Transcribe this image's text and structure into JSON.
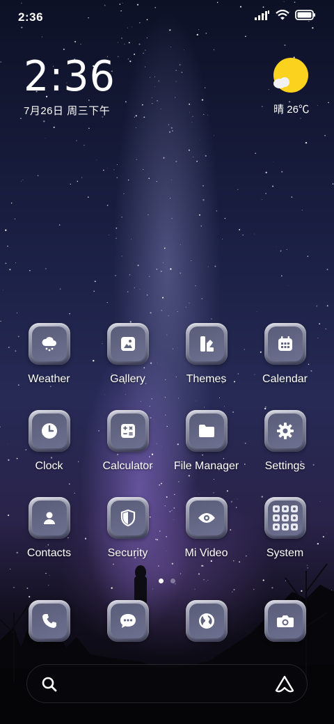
{
  "status_bar": {
    "time": "2:36",
    "icons": [
      "signal-icon",
      "wifi-icon",
      "battery-icon"
    ]
  },
  "clock_widget": {
    "time": "2:36",
    "date": "7月26日 周三下午"
  },
  "weather_widget": {
    "icon": "sun-cloud-icon",
    "text": "晴 26℃"
  },
  "apps": [
    {
      "label": "Weather",
      "icon": "weather-icon"
    },
    {
      "label": "Gallery",
      "icon": "gallery-icon"
    },
    {
      "label": "Themes",
      "icon": "themes-icon"
    },
    {
      "label": "Calendar",
      "icon": "calendar-icon"
    },
    {
      "label": "Clock",
      "icon": "clock-icon"
    },
    {
      "label": "Calculator",
      "icon": "calculator-icon"
    },
    {
      "label": "File Manager",
      "icon": "folder-icon"
    },
    {
      "label": "Settings",
      "icon": "gear-icon"
    },
    {
      "label": "Contacts",
      "icon": "contacts-icon"
    },
    {
      "label": "Security",
      "icon": "shield-icon"
    },
    {
      "label": "Mi Video",
      "icon": "eye-icon"
    },
    {
      "label": "System",
      "icon": "folder-grid-icon"
    }
  ],
  "pager": {
    "pages": 2,
    "active": 1
  },
  "dock": [
    {
      "icon": "phone-icon"
    },
    {
      "icon": "message-icon"
    },
    {
      "icon": "browser-icon"
    },
    {
      "icon": "camera-icon"
    }
  ],
  "search": {
    "icon": "search-icon",
    "assistant_icon": "assistant-icon"
  },
  "colors": {
    "sun": "#fbd21e",
    "tile_inner": "#5f627f"
  }
}
